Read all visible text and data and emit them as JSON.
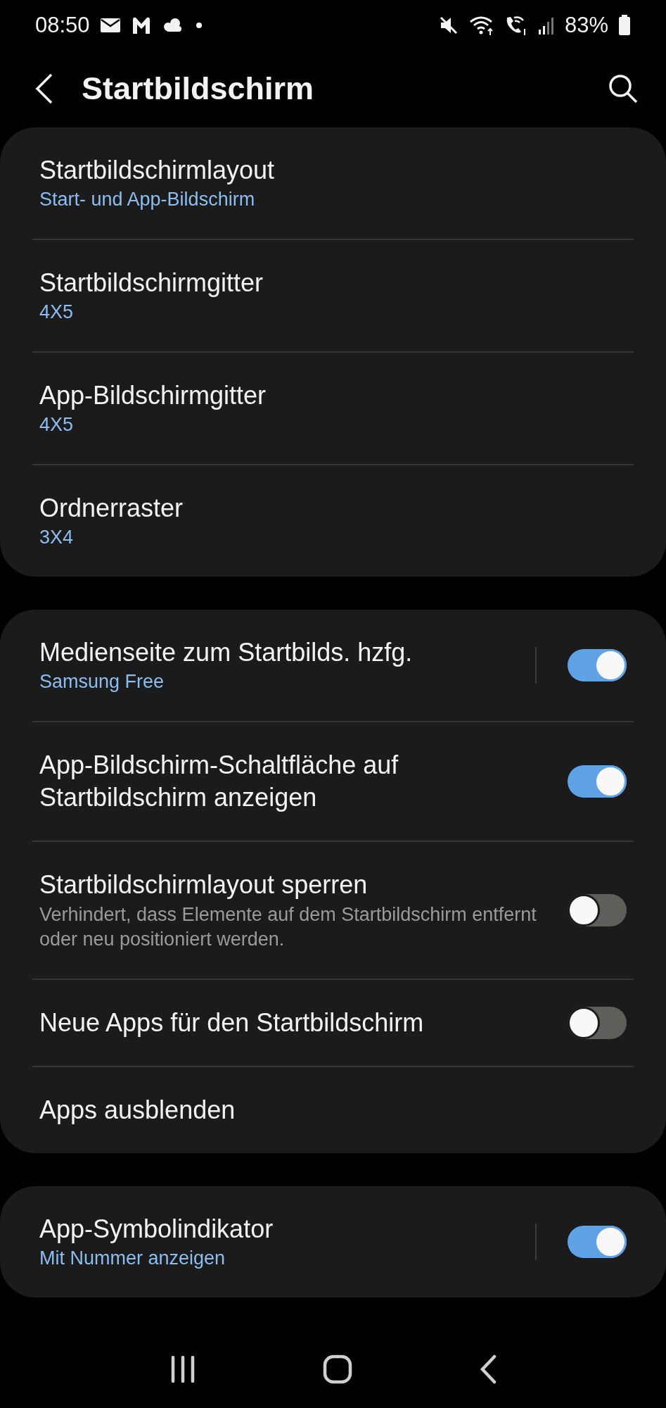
{
  "status_bar": {
    "time": "08:50",
    "battery": "83%"
  },
  "header": {
    "title": "Startbildschirm"
  },
  "groups": [
    {
      "rows": [
        {
          "kind": "plain",
          "title": "Startbildschirmlayout",
          "summary": "Start- und App-Bildschirm"
        },
        {
          "kind": "plain",
          "title": "Startbildschirmgitter",
          "summary": "4X5"
        },
        {
          "kind": "plain",
          "title": "App-Bildschirmgitter",
          "summary": "4X5"
        },
        {
          "kind": "plain",
          "title": "Ordnerraster",
          "summary": "3X4"
        }
      ]
    },
    {
      "rows": [
        {
          "kind": "split-toggle",
          "title": "Medienseite zum Startbilds. hzfg.",
          "summary": "Samsung Free",
          "on": true
        },
        {
          "kind": "toggle",
          "title": "App-Bildschirm-Schaltfläche auf Startbildschirm anzeigen",
          "on": true
        },
        {
          "kind": "toggle",
          "title": "Startbildschirmlayout sperren",
          "description": "Verhindert, dass Elemente auf dem Startbildschirm entfernt oder neu positioniert werden.",
          "on": false
        },
        {
          "kind": "toggle",
          "title": "Neue Apps für den Startbildschirm",
          "on": false
        },
        {
          "kind": "plain",
          "title": "Apps ausblenden"
        }
      ]
    },
    {
      "rows": [
        {
          "kind": "split-toggle",
          "title": "App-Symbolindikator",
          "summary": "Mit Nummer anzeigen",
          "on": true
        }
      ]
    }
  ]
}
